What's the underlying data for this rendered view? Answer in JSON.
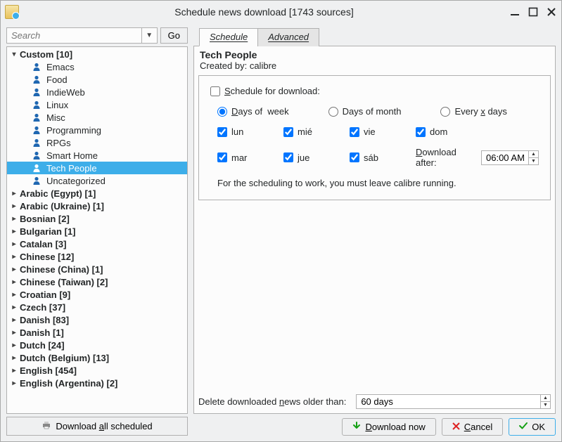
{
  "window": {
    "title": "Schedule news download [1743 sources]"
  },
  "search": {
    "placeholder": "Search",
    "go_label": "Go"
  },
  "tree": {
    "custom_label": "Custom [10]",
    "custom_children": [
      "Emacs",
      "Food",
      "IndieWeb",
      "Linux",
      "Misc",
      "Programming",
      "RPGs",
      "Smart Home",
      "Tech People",
      "Uncategorized"
    ],
    "selected_child": "Tech People",
    "groups": [
      "Arabic (Egypt) [1]",
      "Arabic (Ukraine) [1]",
      "Bosnian [2]",
      "Bulgarian [1]",
      "Catalan [3]",
      "Chinese [12]",
      "Chinese (China) [1]",
      "Chinese (Taiwan) [2]",
      "Croatian [9]",
      "Czech [37]",
      "Danish [83]",
      "Danish [1]",
      "Dutch [24]",
      "Dutch (Belgium) [13]",
      "English [454]",
      "English (Argentina) [2]"
    ]
  },
  "download_all_label": "Download all scheduled",
  "tabs": {
    "schedule": "Schedule",
    "advanced": "Advanced"
  },
  "recipe": {
    "title": "Tech People",
    "created_by_label": "Created by:",
    "creator": "calibre"
  },
  "schedule": {
    "checkbox_label": "Schedule for download:",
    "radio_days_of_week": "Days of  week",
    "radio_days_of_month": "Days of month",
    "radio_every_x_days": "Every x days",
    "days": {
      "lun": "lun",
      "mar": "mar",
      "mie": "mié",
      "jue": "jue",
      "vie": "vie",
      "sab": "sáb",
      "dom": "dom"
    },
    "download_after_label": "Download after:",
    "download_after_value": "06:00 AM",
    "note": "For the scheduling to work, you must leave calibre running."
  },
  "older": {
    "label": "Delete downloaded news older than:",
    "value": "60 days"
  },
  "footer": {
    "download_now": "Download now",
    "cancel": "Cancel",
    "ok": "OK"
  }
}
